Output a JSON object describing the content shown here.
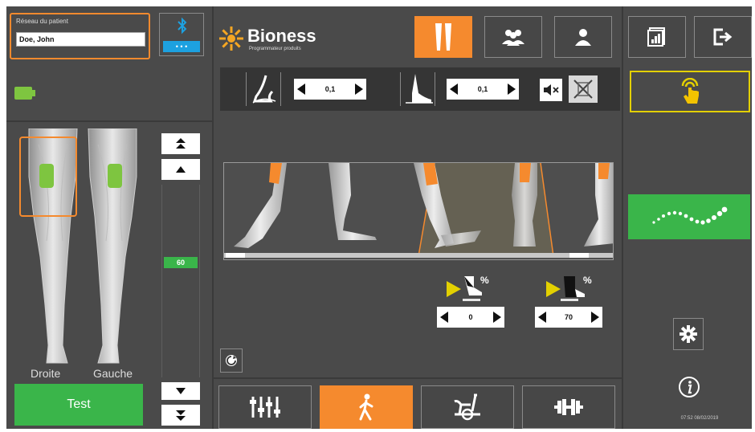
{
  "patient": {
    "label": "Réseau du patient",
    "name": "Doe, John"
  },
  "bluetooth": {
    "status_dots": "• • •"
  },
  "brand": {
    "name": "Bioness",
    "tagline": "Programmateur produits"
  },
  "legs": {
    "right_label": "Droite",
    "left_label": "Gauche"
  },
  "intensity": {
    "value": "60",
    "level_fraction": 0.6
  },
  "test_button": {
    "label": "Test"
  },
  "toolbar": {
    "heel_value": "0,1",
    "foot_value": "0,1"
  },
  "gait": {
    "start_percent_value": "0",
    "end_percent_value": "70",
    "percent_symbol": "%"
  },
  "status": {
    "timestamp": "07:52 08/02/2019"
  },
  "colors": {
    "accent_orange": "#f58a2e",
    "active_green": "#3ab54a",
    "highlight_yellow": "#e3d000",
    "bluetooth_blue": "#1da1e0"
  },
  "icons": {
    "legs_mode": "legs-icon",
    "group": "group-icon",
    "single_user": "user-icon",
    "report": "chart-report-icon",
    "exit": "exit-icon",
    "touch": "touch-hand-icon",
    "waveform": "wave-icon",
    "settings": "gear-icon",
    "info": "info-icon",
    "mixer": "mixer-icon",
    "walk": "walk-icon",
    "bike": "bike-icon",
    "dumbbell": "dumbbell-icon"
  }
}
